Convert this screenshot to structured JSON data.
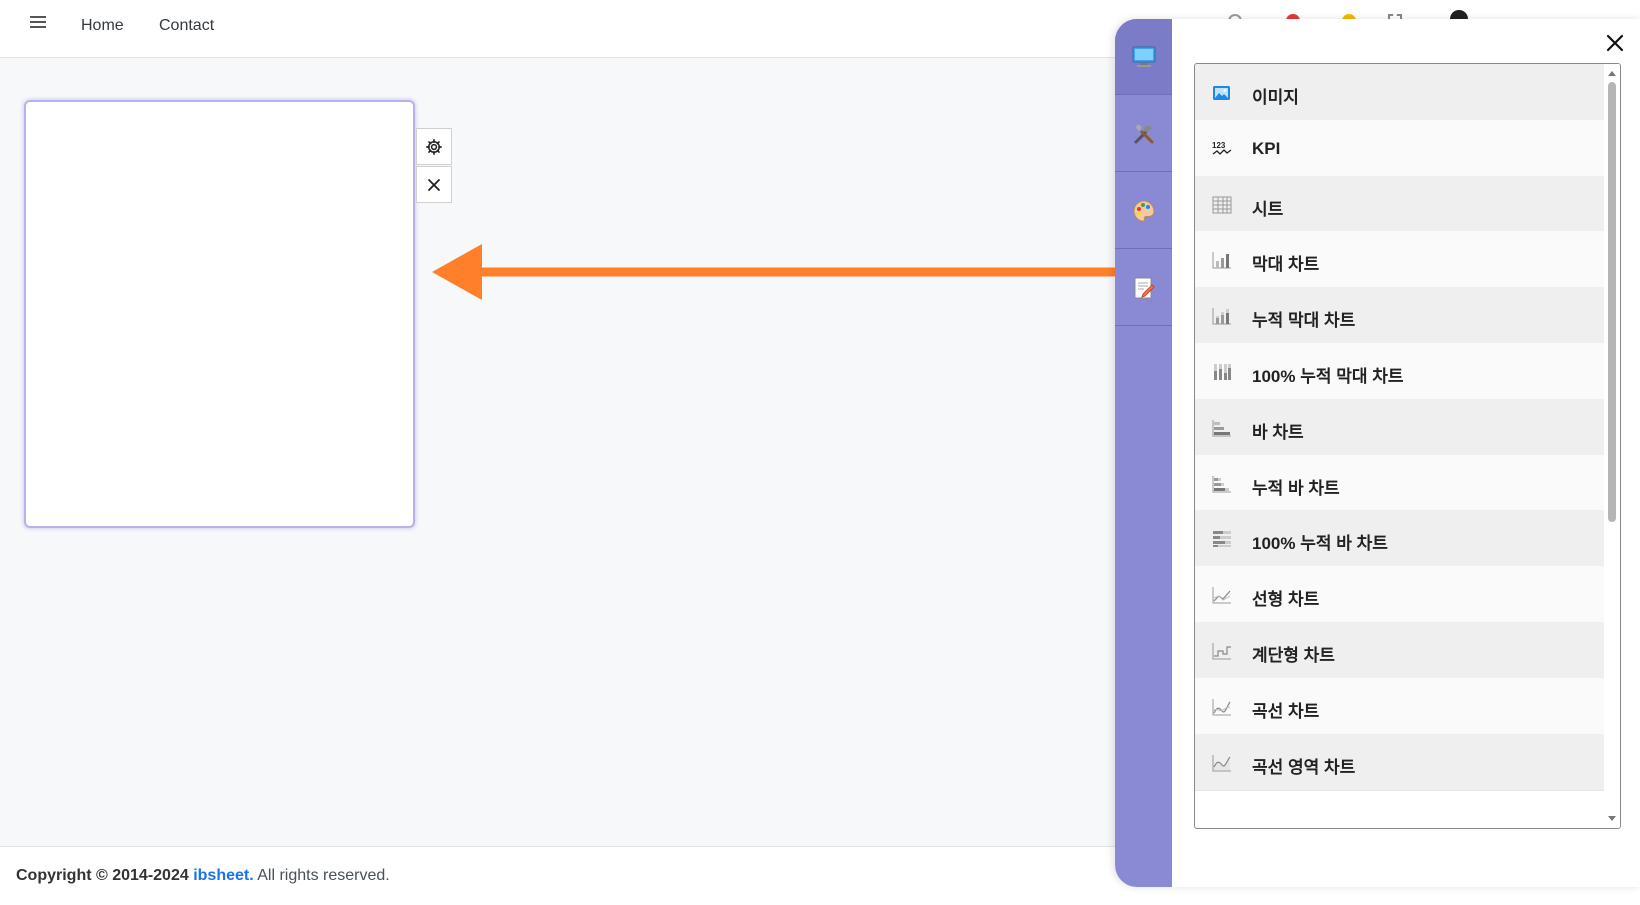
{
  "nav": {
    "menu_icon": "hamburger-icon",
    "home": "Home",
    "contact": "Contact"
  },
  "footer": {
    "copyright": "Copyright © 2014-2024",
    "brand": "ibsheet.",
    "rights": "All rights reserved."
  },
  "widget": {
    "settings_icon": "gear-icon",
    "close_icon": "close-icon"
  },
  "panel": {
    "rail_tabs": [
      {
        "icon": "monitor-icon"
      },
      {
        "icon": "tools-icon"
      },
      {
        "icon": "palette-icon"
      },
      {
        "icon": "edit-document-icon"
      }
    ],
    "close_icon": "close-icon",
    "items": [
      {
        "label": "이미지",
        "icon": "image-icon"
      },
      {
        "label": "KPI",
        "icon": "kpi-icon"
      },
      {
        "label": "시트",
        "icon": "grid-icon"
      },
      {
        "label": "막대 차트",
        "icon": "bar-chart-icon"
      },
      {
        "label": "누적 막대 차트",
        "icon": "stacked-bar-chart-icon"
      },
      {
        "label": "100% 누적 막대 차트",
        "icon": "percent-stacked-bar-chart-icon"
      },
      {
        "label": "바 차트",
        "icon": "horizontal-bar-chart-icon"
      },
      {
        "label": "누적 바 차트",
        "icon": "stacked-horizontal-bar-chart-icon"
      },
      {
        "label": "100% 누적 바 차트",
        "icon": "percent-stacked-horizontal-bar-chart-icon"
      },
      {
        "label": "선형 차트",
        "icon": "line-chart-icon"
      },
      {
        "label": "계단형 차트",
        "icon": "step-chart-icon"
      },
      {
        "label": "곡선 차트",
        "icon": "spline-chart-icon"
      },
      {
        "label": "곡선 영역 차트",
        "icon": "spline-area-chart-icon"
      }
    ]
  },
  "colors": {
    "rail": "#8a89d3",
    "arrow": "#ff7f2a",
    "brand": "#1a73e8"
  }
}
